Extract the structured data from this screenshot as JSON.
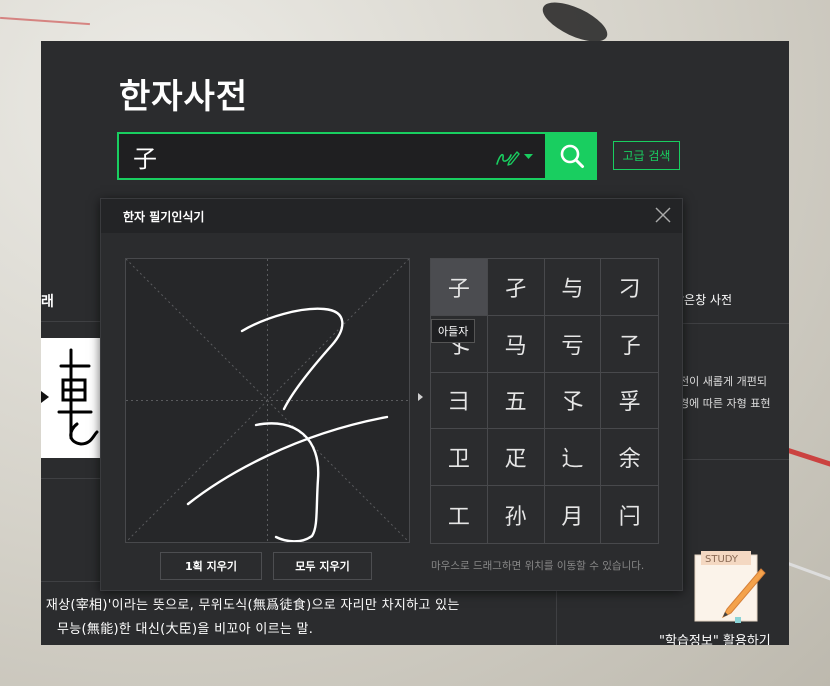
{
  "app": {
    "title": "한자사전",
    "search_value": "子",
    "search_placeholder": "",
    "advanced_search_label": "고급 검색",
    "accent_color": "#19ce60"
  },
  "background": {
    "left_panel_label": "래",
    "meaning_line1": "· 재상(宰相)'이라는 뜻으로, 무위도식(無爲徒食)으로 자리만 차지하고 있는",
    "meaning_line2": "무능(無能)한 대신(大臣)을 비꼬아 이르는 말.",
    "right_title": "맑은창 사전",
    "right_line1": "전이 새롭게 개편되",
    "right_line2": "경에 따른 자형 표현",
    "study_badge": "STUDY",
    "study_caption": "\"학습정보\" 활용하기"
  },
  "recognizer": {
    "title": "한자 필기인식기",
    "clear_one_label": "1획 지우기",
    "clear_all_label": "모두 지우기",
    "hint": "마우스로 드래그하면 위치를 이동할 수 있습니다.",
    "tooltip": "아들자",
    "candidates": [
      "子",
      "孑",
      "与",
      "刁",
      "孓",
      "马",
      "亏",
      "孒",
      "彐",
      "五",
      "孓",
      "孚",
      "卫",
      "疋",
      "辶",
      "余",
      "工",
      "孙",
      "月",
      "闩"
    ]
  },
  "icons": {
    "search": "search-icon",
    "handwriting": "handwriting-pen-icon",
    "dropdown": "chevron-down-icon",
    "close": "close-icon"
  }
}
